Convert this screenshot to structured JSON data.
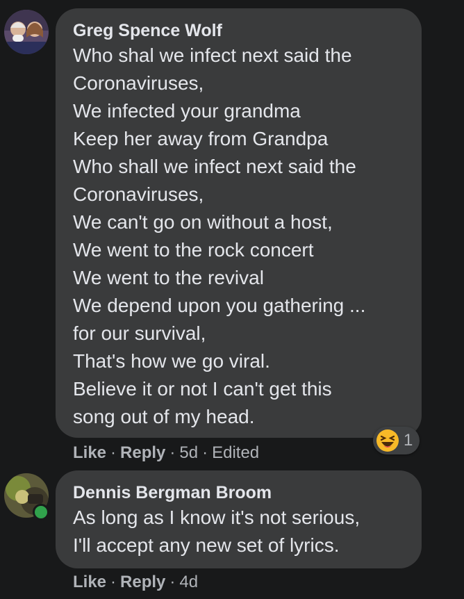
{
  "comments": [
    {
      "author": "Greg Spence Wolf",
      "lines": [
        "Who shal we infect next said the",
        "Coronaviruses,",
        "We infected your grandma",
        "Keep her away from Grandpa",
        "Who shall we infect next said the",
        "Coronaviruses,",
        "We can't go on without a host,",
        "We went to the rock concert",
        "We went to the revival",
        "We depend upon you gathering ...",
        "for our survival,",
        "That's how we go viral.",
        "Believe it or not I can't get this",
        "song out of my head."
      ],
      "like_label": "Like",
      "reply_label": "Reply",
      "time": "5d",
      "edited": "Edited",
      "reaction": {
        "icon": "haha-emoji-icon",
        "count": "1",
        "color": "#f7b928"
      }
    },
    {
      "author": "Dennis Bergman Broom",
      "lines": [
        "As long as I know it's not serious,",
        "I'll accept any new set of lyrics."
      ],
      "like_label": "Like",
      "reply_label": "Reply",
      "time": "4d",
      "online": true
    }
  ],
  "separator": "·",
  "colors": {
    "background": "#18191a",
    "bubble": "#3a3b3c",
    "text": "#e4e6eb",
    "secondary_text": "#b0b3b8",
    "online": "#31a24c"
  }
}
